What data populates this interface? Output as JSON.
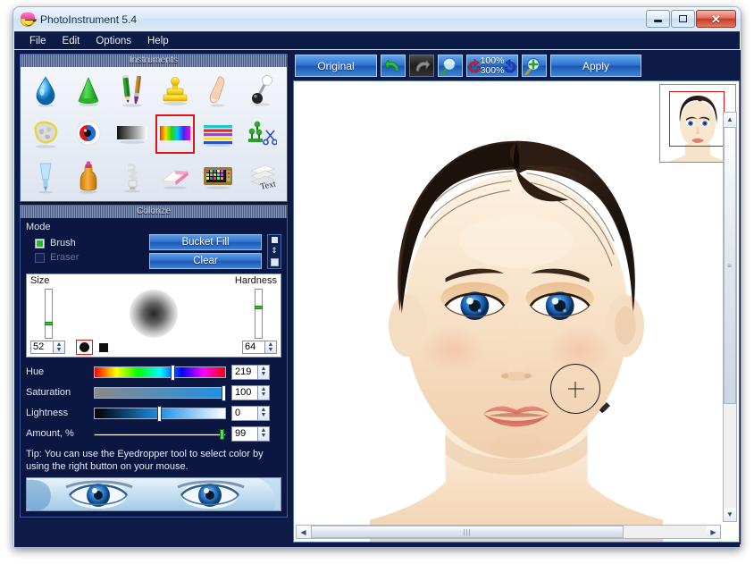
{
  "window": {
    "title": "PhotoInstrument 5.4",
    "icon": "smiley-face-icon",
    "buttons": {
      "minimize": "minimize-icon",
      "maximize": "maximize-icon",
      "close": "✕"
    }
  },
  "menubar": {
    "items": [
      "File",
      "Edit",
      "Options",
      "Help"
    ]
  },
  "instruments": {
    "title": "Instruments",
    "tools": [
      {
        "name": "blur-tool",
        "icon": "water-drop"
      },
      {
        "name": "sharpen-tool",
        "icon": "green-cone"
      },
      {
        "name": "pencil-brush-tool",
        "icon": "pencil-and-brush"
      },
      {
        "name": "clone-stamp-tool",
        "icon": "yellow-stamp"
      },
      {
        "name": "smudge-tool",
        "icon": "finger"
      },
      {
        "name": "push-tool",
        "icon": "pin-ball"
      },
      {
        "name": "texture-tool",
        "icon": "stone-patch"
      },
      {
        "name": "red-eye-tool",
        "icon": "red-eye"
      },
      {
        "name": "gradient-tool",
        "icon": "gray-gradient"
      },
      {
        "name": "colorize-tool",
        "icon": "rainbow-spectrum"
      },
      {
        "name": "color-balance-tool",
        "icon": "color-stripes"
      },
      {
        "name": "clone-cut-tool",
        "icon": "scissors-pins"
      },
      {
        "name": "airbrush-tool",
        "icon": "blue-nozzle"
      },
      {
        "name": "liquid-tool",
        "icon": "orange-bottle"
      },
      {
        "name": "lighting-tool",
        "icon": "spiral-bulb"
      },
      {
        "name": "eraser-tool",
        "icon": "eraser"
      },
      {
        "name": "noise-tool",
        "icon": "noise-tv"
      },
      {
        "name": "text-layers-tool",
        "icon": "text-layers"
      }
    ],
    "selected_index": 9
  },
  "colorize": {
    "title": "Colorize",
    "mode_label": "Mode",
    "modes": [
      {
        "label": "Brush",
        "checked": true,
        "enabled": true
      },
      {
        "label": "Eraser",
        "checked": false,
        "enabled": false
      }
    ],
    "bucket_fill_label": "Bucket Fill",
    "clear_label": "Clear",
    "size_label": "Size",
    "hardness_label": "Hardness",
    "size_value": "52",
    "hardness_value": "64",
    "brush_shapes": [
      {
        "name": "round-brush-shape",
        "selected": true
      },
      {
        "name": "square-brush-shape",
        "selected": false
      }
    ],
    "sliders": [
      {
        "label": "Hue",
        "value": "219",
        "pos_pct": 60
      },
      {
        "label": "Saturation",
        "value": "100",
        "pos_pct": 100
      },
      {
        "label": "Lightness",
        "value": "0",
        "pos_pct": 50
      },
      {
        "label": "Amount, %",
        "value": "99",
        "pos_pct": 99
      }
    ],
    "tip_text": "Tip: You can use the Eyedropper tool to select color by using the right button on your mouse.",
    "sample_strip": "blue-eyes-sample"
  },
  "toolbar": {
    "original_label": "Original",
    "apply_label": "Apply",
    "undo_icon": "undo-arrow-icon",
    "redo_icon": "redo-arrow-icon",
    "zoom_out_icon": "zoom-out-icon",
    "zoom_in_icon": "zoom-in-icon",
    "zoom_current": "100%",
    "zoom_max": "300%",
    "rotate_left_icon": "rotate-left-icon",
    "rotate_right_icon": "rotate-right-icon"
  },
  "canvas": {
    "subject": "woman-portrait-blue-eyes",
    "cursor": "brush-circle-cursor",
    "thumbnail": "navigator-thumbnail"
  },
  "colors": {
    "accent_blue": "#2f72cd",
    "panel_dark": "#0b1740",
    "selection_red": "#e21313",
    "check_green": "#16c916",
    "menubar": "#0c1b45",
    "eye_blue": "#1e6fd0"
  }
}
